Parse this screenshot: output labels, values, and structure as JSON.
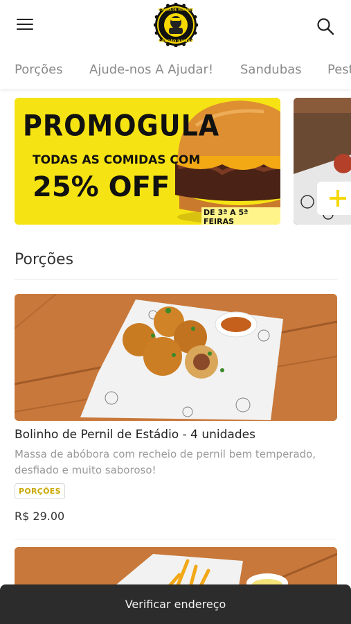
{
  "header": {
    "menu_icon": "hamburger-menu-icon",
    "logo": {
      "icon": "burger-mascot-logo",
      "text_top": "COMIDA DE VERDADE",
      "text_bottom": "GORDÃO DARLEY"
    },
    "search_icon": "search-icon"
  },
  "tabs": [
    {
      "label": "Porções"
    },
    {
      "label": "Ajude-nos A Ajudar!"
    },
    {
      "label": "Sandubas"
    },
    {
      "label": "Pest"
    }
  ],
  "banner": {
    "title": "PROMOGULA",
    "subtitle": "TODAS AS COMIDAS COM",
    "offer": "25% OFF",
    "days": "DE 3ª A 5ª FEIRAS",
    "background": "#f6e313"
  },
  "plus_icon": "plus-icon",
  "section": {
    "title": "Porções"
  },
  "product": {
    "name": "Bolinho de Pernil de Estádio - 4 unidades",
    "description": "Massa de abóbora com recheio de pernil bem temperado, desfiado e muito saboroso!",
    "tag": "PORÇÕES",
    "price": "R$ 29.00"
  },
  "bottom_bar": {
    "label": "Verificar endereço"
  },
  "colors": {
    "accent": "#f6d800",
    "tag_text": "#c9a800",
    "bar": "#2c2c2c"
  }
}
